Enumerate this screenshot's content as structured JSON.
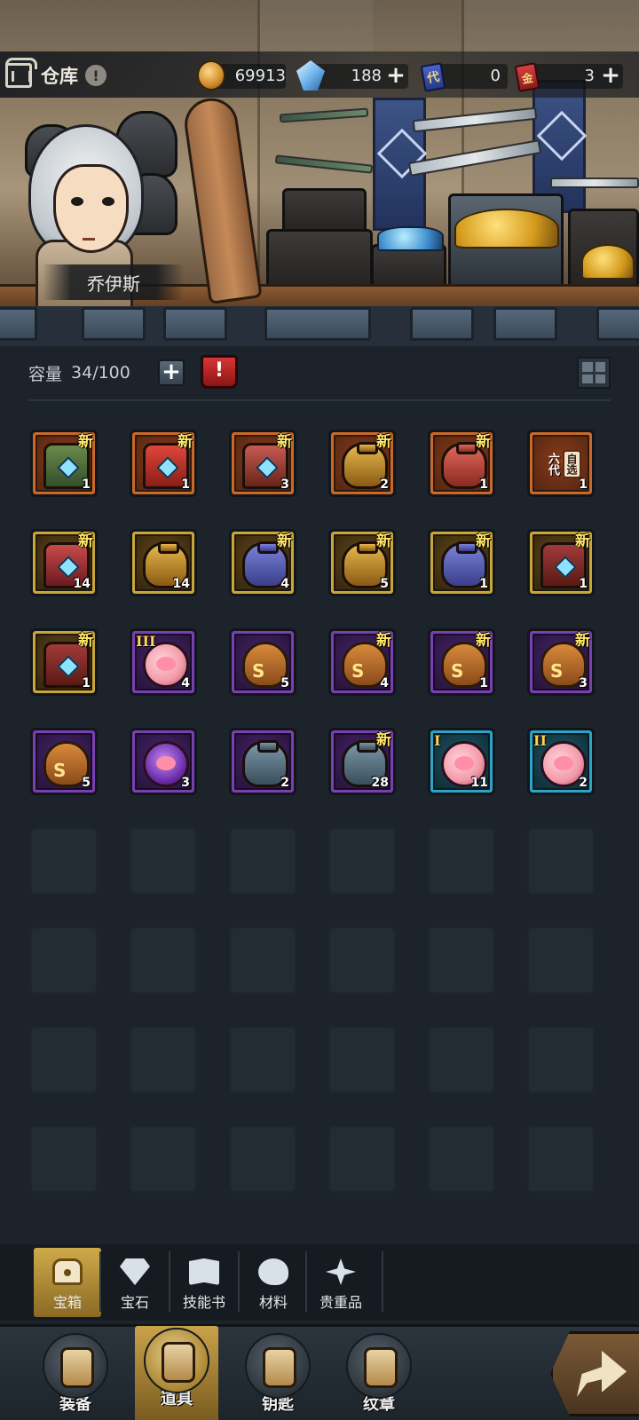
{
  "header": {
    "title": "仓库",
    "info_icon": "exclamation-badge",
    "character_name": "乔伊斯"
  },
  "currencies": [
    {
      "icon": "coin-icon",
      "value": "69913",
      "has_plus": false
    },
    {
      "icon": "crystal-icon",
      "value": "188",
      "has_plus": true
    },
    {
      "icon": "blue-card-icon",
      "icon_text": "代",
      "value": "0",
      "has_plus": false
    },
    {
      "icon": "red-card-icon",
      "icon_text": "金",
      "value": "3",
      "has_plus": true
    }
  ],
  "capacity": {
    "label": "容量",
    "value": "34/100"
  },
  "new_tag": "新",
  "items": [
    {
      "art": "green-helmet-chest",
      "count": "1",
      "is_new": true,
      "rarity": "orange"
    },
    {
      "art": "royal-crest-chest",
      "count": "1",
      "is_new": true,
      "rarity": "orange"
    },
    {
      "art": "red-chest",
      "count": "3",
      "is_new": true,
      "rarity": "orange"
    },
    {
      "art": "gold-jar",
      "count": "2",
      "is_new": true,
      "rarity": "orange"
    },
    {
      "art": "red-jar",
      "count": "1",
      "is_new": true,
      "rarity": "orange"
    },
    {
      "art": "select-chest",
      "count": "1",
      "is_new": false,
      "rarity": "orange",
      "stamp_left": "六代",
      "stamp_right": "自选"
    },
    {
      "art": "crest-chest",
      "count": "14",
      "is_new": true,
      "rarity": "gold"
    },
    {
      "art": "gold-jar",
      "count": "14",
      "is_new": false,
      "rarity": "gold"
    },
    {
      "art": "blue-jar",
      "count": "4",
      "is_new": true,
      "rarity": "gold"
    },
    {
      "art": "gold-jar",
      "count": "5",
      "is_new": true,
      "rarity": "gold"
    },
    {
      "art": "blue-jar",
      "count": "1",
      "is_new": true,
      "rarity": "gold"
    },
    {
      "art": "ribbon-chest",
      "count": "1",
      "is_new": true,
      "rarity": "gold"
    },
    {
      "art": "ribbon-chest",
      "count": "1",
      "is_new": true,
      "rarity": "gold"
    },
    {
      "art": "egg-bag",
      "count": "4",
      "is_new": false,
      "rarity": "purple",
      "tier": "III"
    },
    {
      "art": "coin-bag",
      "count": "5",
      "is_new": false,
      "rarity": "purple"
    },
    {
      "art": "coin-bag",
      "count": "4",
      "is_new": true,
      "rarity": "purple"
    },
    {
      "art": "coin-bag",
      "count": "1",
      "is_new": true,
      "rarity": "purple"
    },
    {
      "art": "coin-bag",
      "count": "3",
      "is_new": true,
      "rarity": "purple"
    },
    {
      "art": "coin-bag",
      "count": "5",
      "is_new": false,
      "rarity": "purple"
    },
    {
      "art": "purple-gem-bag",
      "count": "3",
      "is_new": false,
      "rarity": "purple"
    },
    {
      "art": "steel-jar",
      "count": "2",
      "is_new": false,
      "rarity": "purple"
    },
    {
      "art": "steel-jar",
      "count": "28",
      "is_new": true,
      "rarity": "purple"
    },
    {
      "art": "egg-bag",
      "count": "11",
      "is_new": false,
      "rarity": "blue",
      "tier": "I"
    },
    {
      "art": "egg-bag",
      "count": "2",
      "is_new": false,
      "rarity": "blue",
      "tier": "II"
    }
  ],
  "categories": [
    {
      "label": "宝箱",
      "icon": "chest-icon",
      "active": true
    },
    {
      "label": "宝石",
      "icon": "gem-icon",
      "active": false
    },
    {
      "label": "技能书",
      "icon": "book-icon",
      "active": false
    },
    {
      "label": "材料",
      "icon": "material-icon",
      "active": false
    },
    {
      "label": "贵重品",
      "icon": "valuables-icon",
      "active": false
    }
  ],
  "nav": [
    {
      "label": "装备",
      "icon": "equipment-icon",
      "active": false
    },
    {
      "label": "道具",
      "icon": "items-icon",
      "active": true
    },
    {
      "label": "钥匙",
      "icon": "key-icon",
      "active": false
    },
    {
      "label": "纹章",
      "icon": "emblem-icon",
      "active": false
    }
  ],
  "colors": {
    "orange_frame": "#c8692a",
    "gold_frame": "#c9a63c",
    "purple_frame": "#7a3fb0",
    "blue_frame": "#2ea3c8",
    "new_tag": "#ffe667",
    "active_tab": "#cfaa4a"
  }
}
